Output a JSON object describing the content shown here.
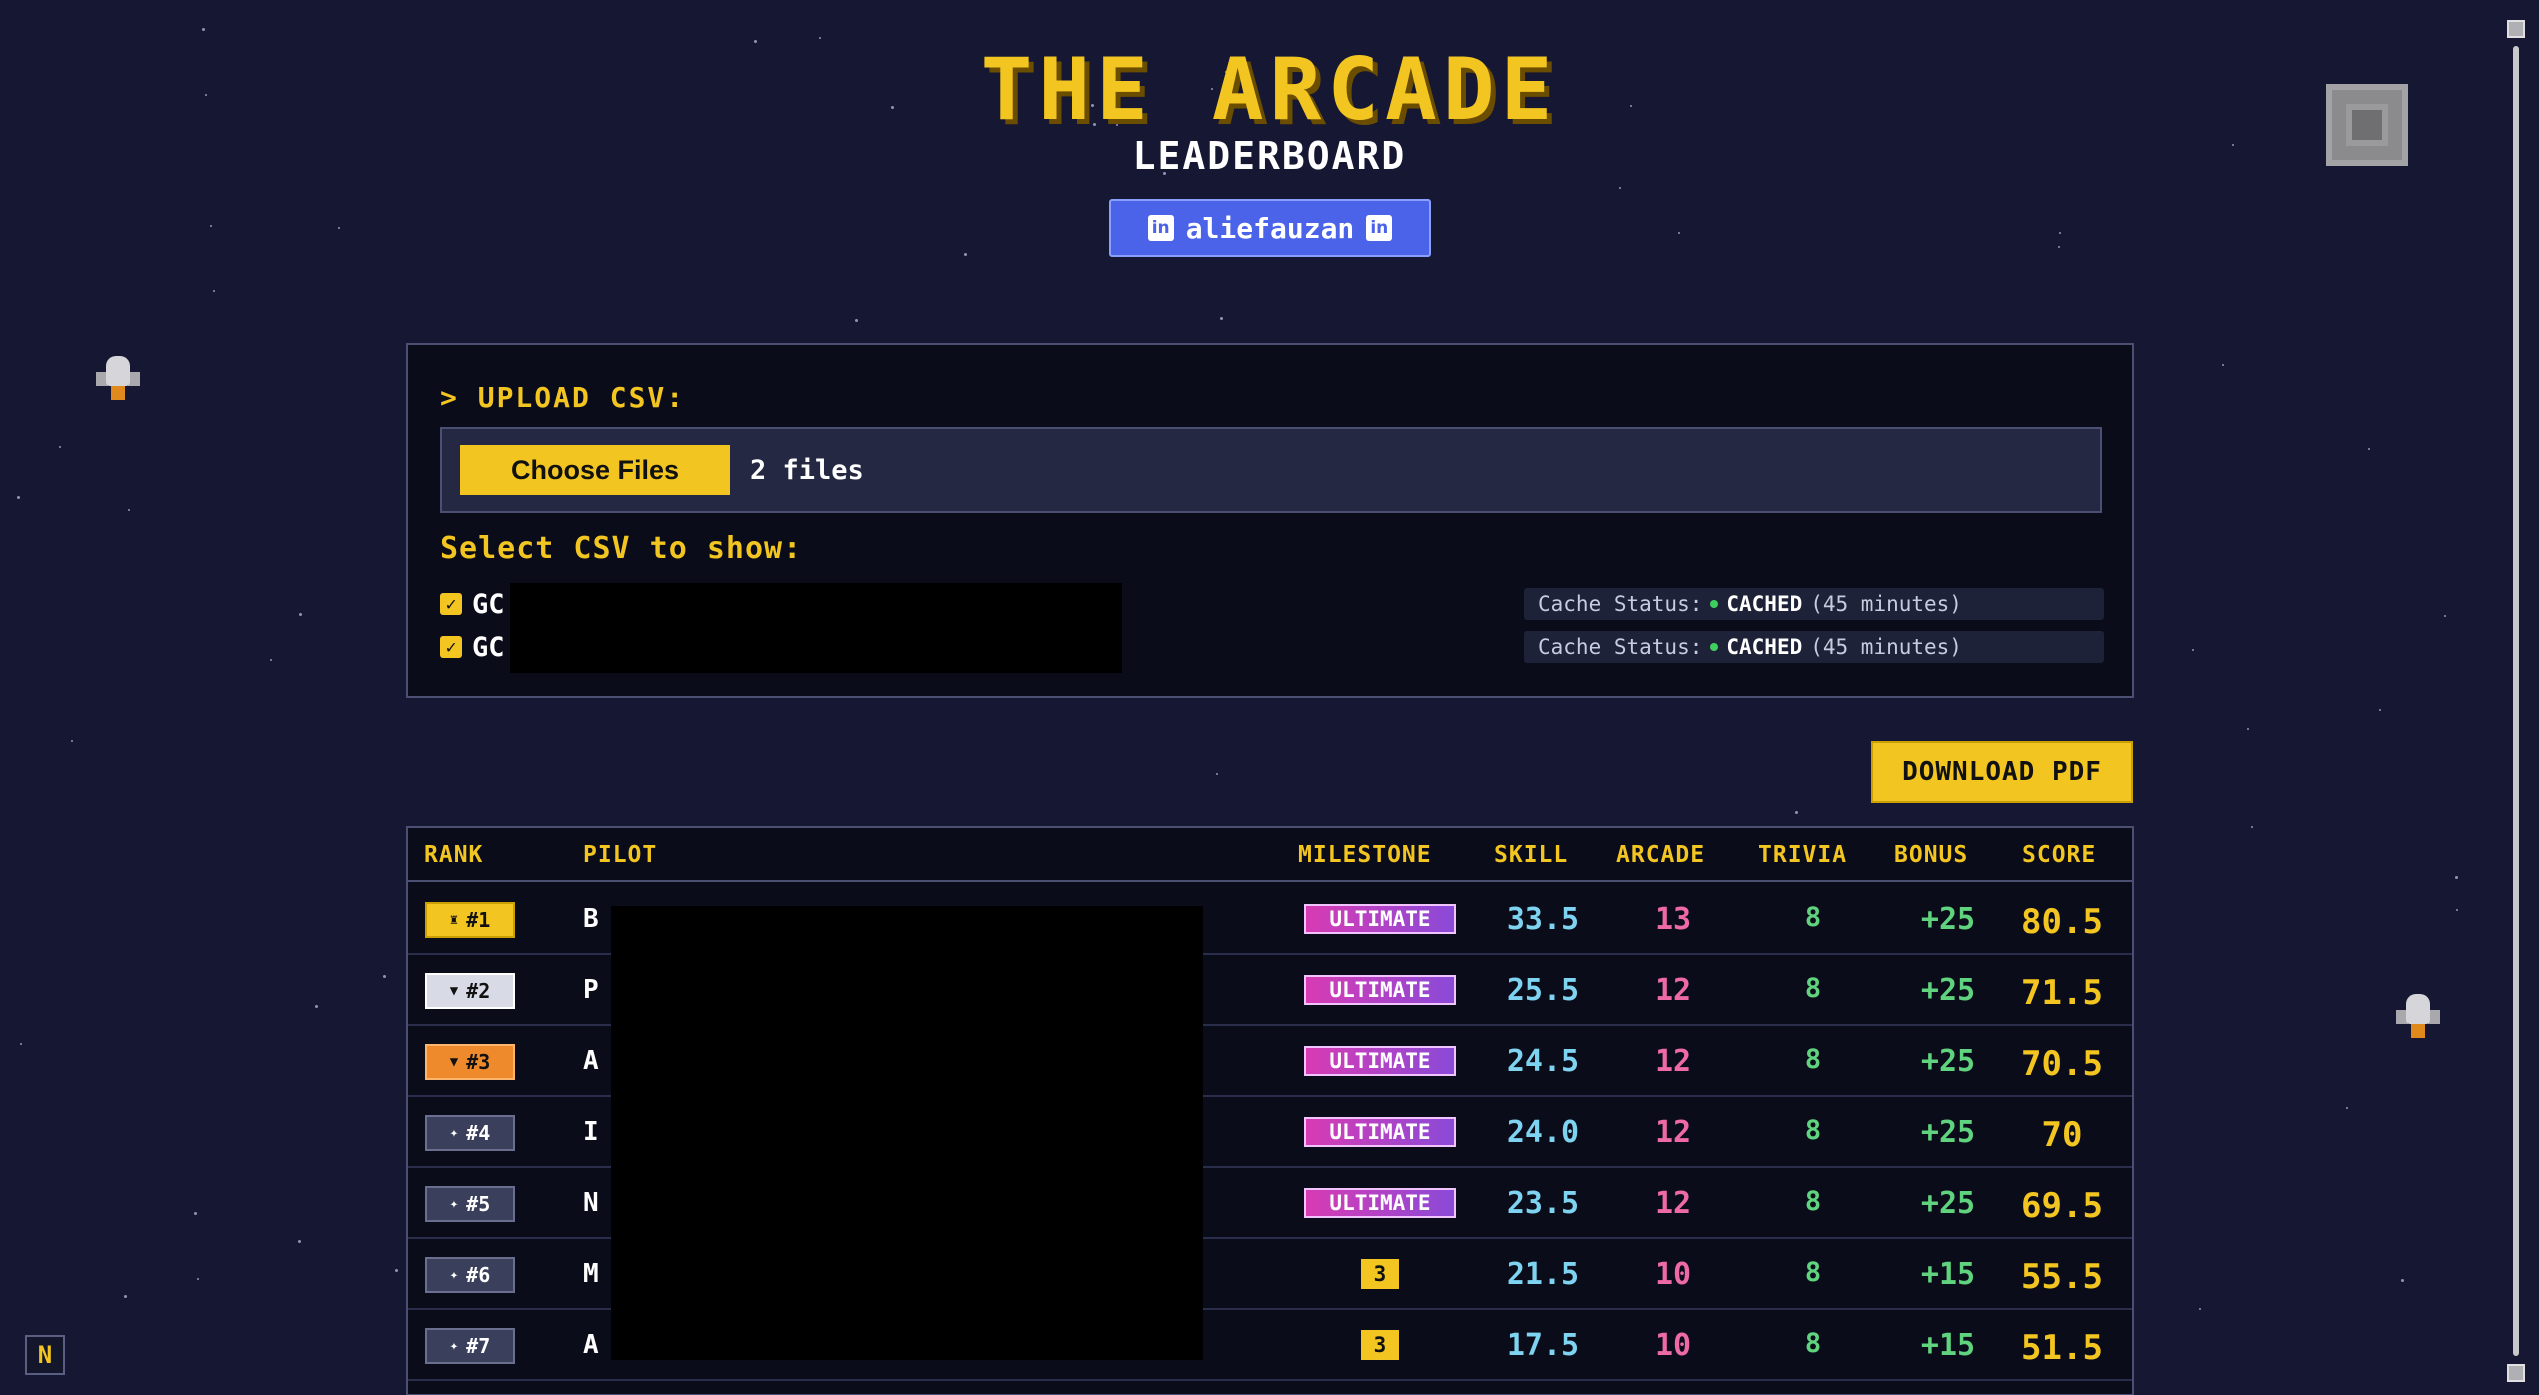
{
  "header": {
    "title": "THE ARCADE",
    "subtitle": "LEADERBOARD",
    "profile_name": "aliefauzan",
    "profile_icon": "linkedin-icon",
    "profile_icon_text": "in"
  },
  "upload": {
    "heading": "> UPLOAD CSV:",
    "choose_label": "Choose Files",
    "file_count": "2 files",
    "select_label": "Select CSV to show:",
    "csv_files": [
      {
        "name": "GC",
        "checked": true,
        "cache_label": "Cache Status:",
        "cache_state": "CACHED",
        "cache_age": "(45 minutes)"
      },
      {
        "name": "GC",
        "checked": true,
        "cache_label": "Cache Status:",
        "cache_state": "CACHED",
        "cache_age": "(45 minutes)"
      }
    ]
  },
  "actions": {
    "download_pdf": "DOWNLOAD PDF"
  },
  "table": {
    "columns": [
      "RANK",
      "PILOT",
      "MILESTONE",
      "SKILL",
      "ARCADE",
      "TRIVIA",
      "BONUS",
      "SCORE"
    ],
    "rows": [
      {
        "rank": "#1",
        "rank_icon": "medal-icon",
        "pilot": "B",
        "milestone": "ULTIMATE",
        "skill": "33.5",
        "arcade": "13",
        "trivia": "8",
        "bonus": "+25",
        "score": "80.5"
      },
      {
        "rank": "#2",
        "rank_icon": "trophy-icon",
        "pilot": "P",
        "milestone": "ULTIMATE",
        "skill": "25.5",
        "arcade": "12",
        "trivia": "8",
        "bonus": "+25",
        "score": "71.5"
      },
      {
        "rank": "#3",
        "rank_icon": "trophy-icon",
        "pilot": "A",
        "milestone": "ULTIMATE",
        "skill": "24.5",
        "arcade": "12",
        "trivia": "8",
        "bonus": "+25",
        "score": "70.5"
      },
      {
        "rank": "#4",
        "rank_icon": "star-icon",
        "pilot": "I",
        "milestone": "ULTIMATE",
        "skill": "24.0",
        "arcade": "12",
        "trivia": "8",
        "bonus": "+25",
        "score": "70"
      },
      {
        "rank": "#5",
        "rank_icon": "star-icon",
        "pilot": "N",
        "milestone": "ULTIMATE",
        "skill": "23.5",
        "arcade": "12",
        "trivia": "8",
        "bonus": "+25",
        "score": "69.5"
      },
      {
        "rank": "#6",
        "rank_icon": "star-icon",
        "pilot": "M",
        "milestone": "3",
        "skill": "21.5",
        "arcade": "10",
        "trivia": "8",
        "bonus": "+15",
        "score": "55.5"
      },
      {
        "rank": "#7",
        "rank_icon": "star-icon",
        "pilot": "A",
        "milestone": "3",
        "skill": "17.5",
        "arcade": "10",
        "trivia": "8",
        "bonus": "+15",
        "score": "51.5"
      }
    ]
  },
  "corner_badge": "N",
  "colors": {
    "background": "#151733",
    "accent_yellow": "#f2c521",
    "profile_blue": "#4a63e8",
    "skill_cyan": "#7dd3f0",
    "arcade_pink": "#ee6aa6",
    "trivia_green": "#5fd37e",
    "rank1_gold": "#f2c521",
    "rank2_silver": "#d8dbe6",
    "rank3_bronze": "#ef8a2c",
    "rank_other": "#3a3f5c"
  }
}
